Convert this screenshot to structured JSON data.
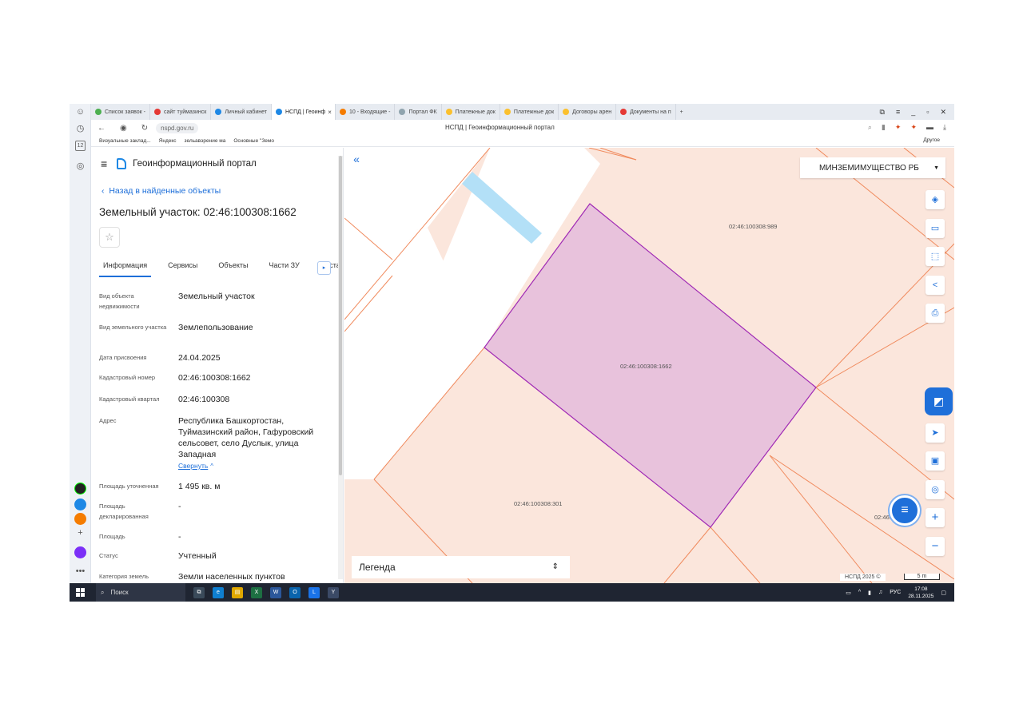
{
  "browser": {
    "tabs": [
      {
        "label": "Список заявок -",
        "color": "#4caf50"
      },
      {
        "label": "сайт туймазинск",
        "color": "#e53935"
      },
      {
        "label": "Личный кабинет",
        "color": "#1e88e5"
      },
      {
        "label": "НСПД | Геоинф",
        "color": "#1e88e5",
        "active": true
      },
      {
        "label": "10 - Входящие -",
        "color": "#f57c00"
      },
      {
        "label": "Портал ФК",
        "color": "#90a4ae"
      },
      {
        "label": "Платежные док",
        "color": "#fbc02d"
      },
      {
        "label": "Платежные док",
        "color": "#fbc02d"
      },
      {
        "label": "Договоры арен",
        "color": "#fbc02d"
      },
      {
        "label": "Документы на п",
        "color": "#e53935"
      }
    ],
    "tab_close": "×",
    "new_tab": "+",
    "url": "nspd.gov.ru",
    "page_title": "НСПД | Геоинформационный портал",
    "bookmarks": [
      "Визуальные заклад...",
      "Яндекс",
      "зельавэрение ма",
      "Основные \"Земо"
    ],
    "bookmarks_other": "Другое"
  },
  "panel": {
    "portal_title": "Геоинформационный портал",
    "back_link": "Назад в найденные объекты",
    "object_title": "Земельный участок: 02:46:100308:1662",
    "tabs": [
      "Информация",
      "Сервисы",
      "Объекты",
      "Части ЗУ",
      "Соста"
    ],
    "rows": [
      {
        "label": "Вид объекта недвижимости",
        "value": "Земельный участок"
      },
      {
        "label": "Вид земельного участка",
        "value": "Землепользование"
      },
      {
        "label": "Дата присвоения",
        "value": "24.04.2025"
      },
      {
        "label": "Кадастровый номер",
        "value": "02:46:100308:1662"
      },
      {
        "label": "Кадастровый квартал",
        "value": "02:46:100308"
      },
      {
        "label": "Адрес",
        "value": "Республика Башкортостан, Туймазинский район, Гафуровский сельсовет, село Дуслык, улица Западная"
      },
      {
        "label": "Площадь уточненная",
        "value": "1 495 кв. м"
      },
      {
        "label": "Площадь декларированная",
        "value": "-"
      },
      {
        "label": "Площадь",
        "value": "-"
      },
      {
        "label": "Статус",
        "value": "Учтенный"
      },
      {
        "label": "Категория земель",
        "value": "Земли населенных пунктов"
      }
    ],
    "collapse_link": "Свернуть"
  },
  "map": {
    "collapse_glyph": "«",
    "layer_select": "МИНЗЕМИМУЩЕСТВО РБ",
    "parcel_labels": {
      "selected": "02:46:100308:1662",
      "north": "02:46:100308:989",
      "south": "02:46:100308:301",
      "east": "02:46:100308:12"
    },
    "legend": "Легенда",
    "copyright": "НСПД 2025 ©",
    "scale": "5 m",
    "colors": {
      "parcel_fill": "#fbe6dc",
      "parcel_line": "#f08a5d",
      "selected_fill": "#e8c2dc",
      "selected_line": "#a02ab5",
      "water": "#b3e0f7",
      "road": "#ffffff"
    }
  },
  "taskbar": {
    "search": "Поиск",
    "lang": "РУС",
    "time": "17:08",
    "date": "28.11.2025"
  }
}
